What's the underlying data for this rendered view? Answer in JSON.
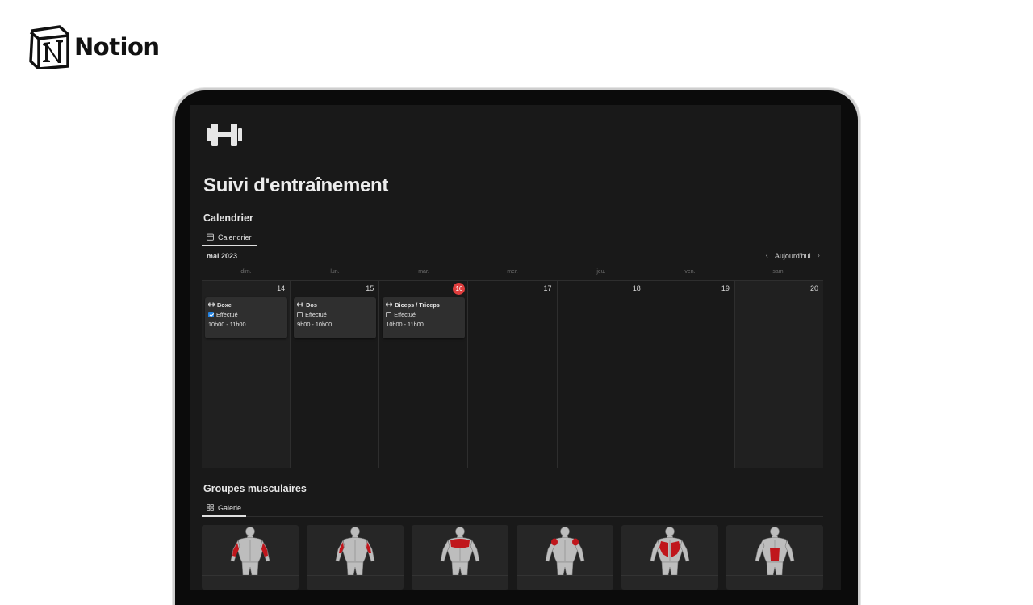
{
  "brand": {
    "name": "Notion",
    "logo_icon": "notion-logo-icon"
  },
  "page": {
    "icon": "dumbbell-icon",
    "title": "Suivi d'entraînement"
  },
  "calendar_section": {
    "title": "Calendrier",
    "view_tab": {
      "label": "Calendrier",
      "icon": "calendar-icon"
    },
    "month": "mai 2023",
    "today_label": "Aujourd'hui",
    "weekdays": [
      "dim.",
      "lun.",
      "mar.",
      "mer.",
      "jeu.",
      "ven.",
      "sam."
    ],
    "days": [
      {
        "num": "14",
        "today": false
      },
      {
        "num": "15",
        "today": false
      },
      {
        "num": "16",
        "today": true
      },
      {
        "num": "17",
        "today": false
      },
      {
        "num": "18",
        "today": false
      },
      {
        "num": "19",
        "today": false
      },
      {
        "num": "20",
        "today": false
      }
    ],
    "events": [
      {
        "title": "Boxe",
        "status": "Effectué",
        "done": true,
        "time": "10h00 - 11h00"
      },
      {
        "title": "Dos",
        "status": "Effectué",
        "done": false,
        "time": "9h00 - 10h00"
      },
      {
        "title": "Biceps / Triceps",
        "status": "Effectué",
        "done": false,
        "time": "10h00 - 11h00"
      }
    ],
    "colors": {
      "today": "#e03e3e",
      "checkbox": "#2383e2"
    }
  },
  "muscle_section": {
    "title": "Groupes musculaires",
    "view_tab": {
      "label": "Galerie",
      "icon": "gallery-grid-icon"
    },
    "highlight_color": "#c0161c",
    "cards": [
      {
        "muscle": "biceps"
      },
      {
        "muscle": "triceps"
      },
      {
        "muscle": "pectoraux"
      },
      {
        "muscle": "épaules"
      },
      {
        "muscle": "dos"
      },
      {
        "muscle": "abdominaux"
      }
    ]
  }
}
